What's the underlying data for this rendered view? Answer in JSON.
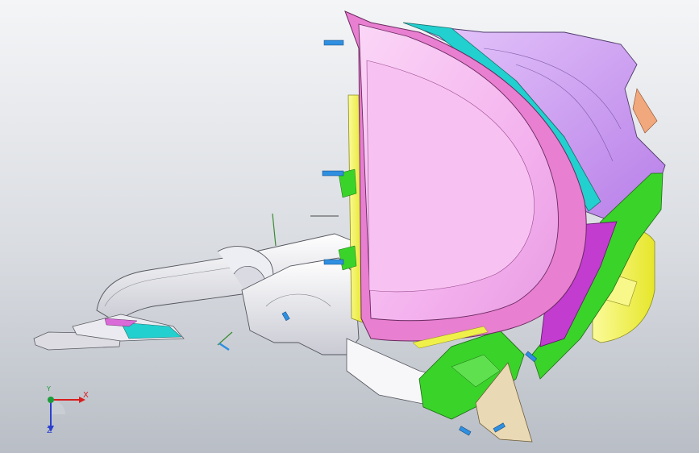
{
  "viewport": {
    "background_top": "#f4f5f7",
    "background_bottom": "#b9bec6"
  },
  "parts": {
    "pink_shell": "#f4b3ee",
    "pink_rim": "#e87fd0",
    "violet_housing": "#c890f2",
    "teal_band": "#22d0cf",
    "yellow_frame": "#f0f04a",
    "green_bracket": "#3ad32a",
    "magenta_panel": "#c23cd0",
    "grey_duct": "#e4e4ea",
    "tan_plate": "#e9d9b4",
    "orange_tab": "#f0a87c",
    "fastener_blue": "#2f8fe0"
  },
  "triad": {
    "x_label": "X",
    "y_label": "Y",
    "z_label": "Z",
    "x_color": "#d81e1e",
    "y_color": "#1c9c3a",
    "z_color": "#2a3fd0"
  }
}
